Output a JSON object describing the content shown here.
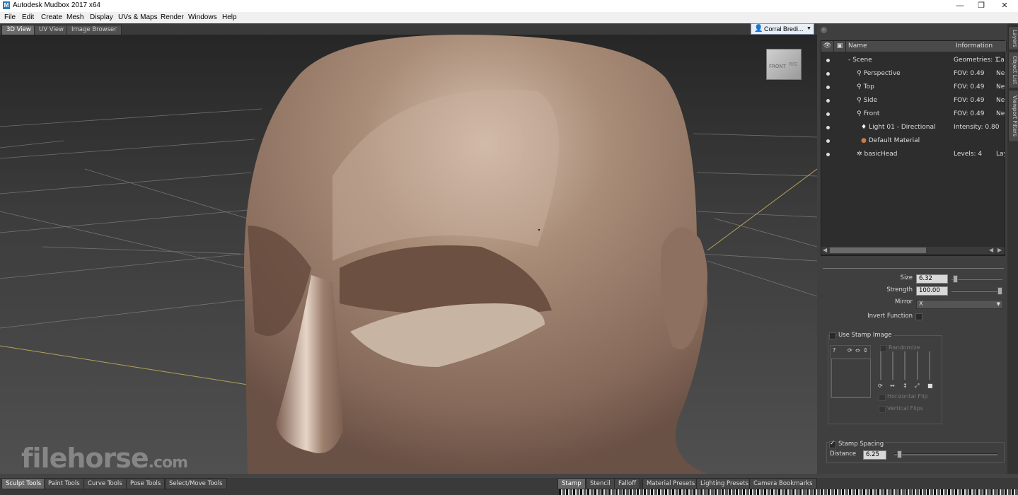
{
  "window": {
    "title": "Autodesk Mudbox 2017 x64",
    "logo_letter": "M",
    "minimize": "—",
    "maximize": "❐",
    "close": "✕"
  },
  "menu": [
    "File",
    "Edit",
    "Create",
    "Mesh",
    "Display",
    "UVs & Maps",
    "Render",
    "Windows",
    "Help"
  ],
  "view_tabs": [
    "3D View",
    "UV View",
    "Image Browser"
  ],
  "user": {
    "name": "Corral Bredi...",
    "icon": "user-icon"
  },
  "viewcube": {
    "front": "FRONT",
    "right": "RIG"
  },
  "side_tabs": [
    "Layers",
    "Object List",
    "Viewport Filters"
  ],
  "object_list": {
    "columns": [
      "Name",
      "Information"
    ],
    "rows": [
      {
        "name": "Scene",
        "info": "Geometries: 1",
        "info2": "Cam",
        "indent": 0,
        "icon": "scene-icon"
      },
      {
        "name": "Perspective",
        "info": "FOV: 0.49",
        "info2": "Nea",
        "indent": 1,
        "icon": "camera-icon"
      },
      {
        "name": "Top",
        "info": "FOV: 0.49",
        "info2": "Nea",
        "indent": 1,
        "icon": "camera-icon"
      },
      {
        "name": "Side",
        "info": "FOV: 0.49",
        "info2": "Nea",
        "indent": 1,
        "icon": "camera-icon"
      },
      {
        "name": "Front",
        "info": "FOV: 0.49",
        "info2": "Nea",
        "indent": 1,
        "icon": "camera-icon"
      },
      {
        "name": "Light 01 - Directional",
        "info": "Intensity: 0.80",
        "info2": "",
        "indent": 1,
        "icon": "light-icon"
      },
      {
        "name": "Default Material",
        "info": "",
        "info2": "",
        "indent": 1,
        "icon": "material-icon"
      },
      {
        "name": "basicHead",
        "info": "Levels: 4",
        "info2": "Lay",
        "indent": 1,
        "icon": "mesh-icon"
      }
    ]
  },
  "properties": {
    "size_label": "Size",
    "size_value": "6.32",
    "size_level": 0.03,
    "strength_label": "Strength",
    "strength_value": "100.00",
    "strength_level": 1.0,
    "mirror_label": "Mirror",
    "mirror_value": "X",
    "invert_label": "Invert Function",
    "use_stamp_label": "Use Stamp Image",
    "randomize_label": "Randomize",
    "hflip_label": "Horizontal Flip",
    "vflip_label": "Vertical Flips",
    "stamp_spacing_label": "Stamp Spacing",
    "distance_label": "Distance",
    "distance_value": "6.25",
    "distance_level": 0.03
  },
  "bottom_tabs_left": [
    "Sculpt Tools",
    "Paint Tools",
    "Curve Tools",
    "Pose Tools",
    "Select/Move Tools"
  ],
  "bottom_tabs_right": [
    "Stamp",
    "Stencil",
    "Falloff",
    "Material Presets",
    "Lighting Presets",
    "Camera Bookmarks"
  ],
  "watermark": {
    "main": "filehorse",
    "suffix": ".com"
  }
}
